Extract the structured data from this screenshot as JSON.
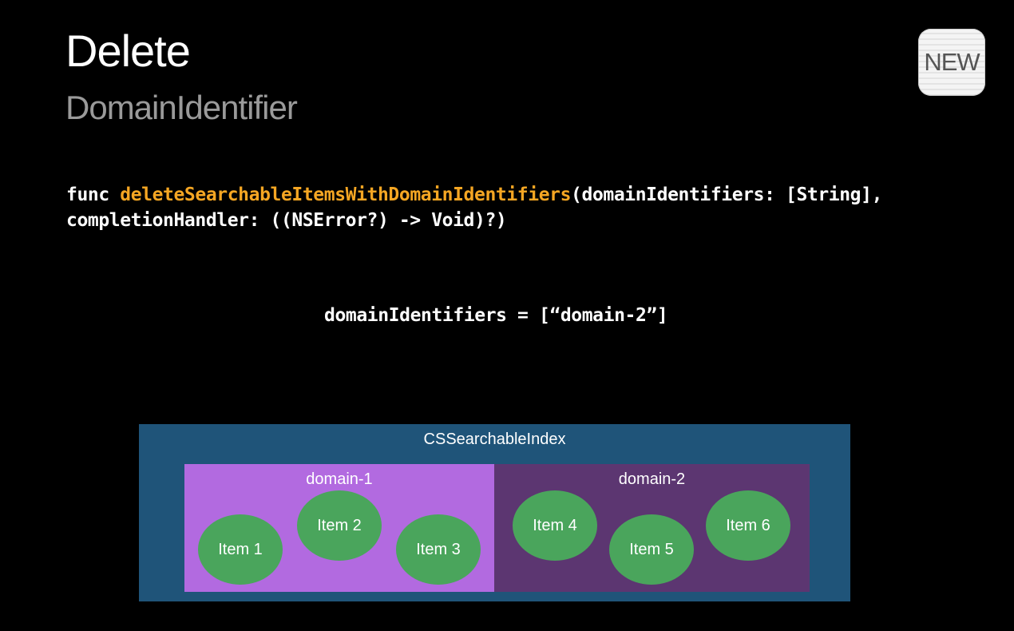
{
  "slide": {
    "title": "Delete",
    "subtitle": "DomainIdentifier",
    "badge": "NEW"
  },
  "code": {
    "keyword": "func ",
    "function_name": "deleteSearchableItemsWithDomainIdentifiers",
    "line1_rest": "(domainIdentifiers: [String],",
    "line2": "completionHandler: ((NSError?) -> Void)?)"
  },
  "assignment": "domainIdentifiers = [“domain-2”]",
  "diagram": {
    "index_label": "CSSearchableIndex",
    "domains": [
      {
        "label": "domain-1",
        "color": "#b26ae0",
        "items": [
          "Item 1",
          "Item 2",
          "Item 3"
        ]
      },
      {
        "label": "domain-2",
        "color": "#5c3671",
        "items": [
          "Item 4",
          "Item 5",
          "Item 6"
        ]
      }
    ],
    "index_color": "#1f5479",
    "item_color": "#4aa55c"
  },
  "colors": {
    "background": "#000000",
    "function_highlight": "#f5a623"
  }
}
